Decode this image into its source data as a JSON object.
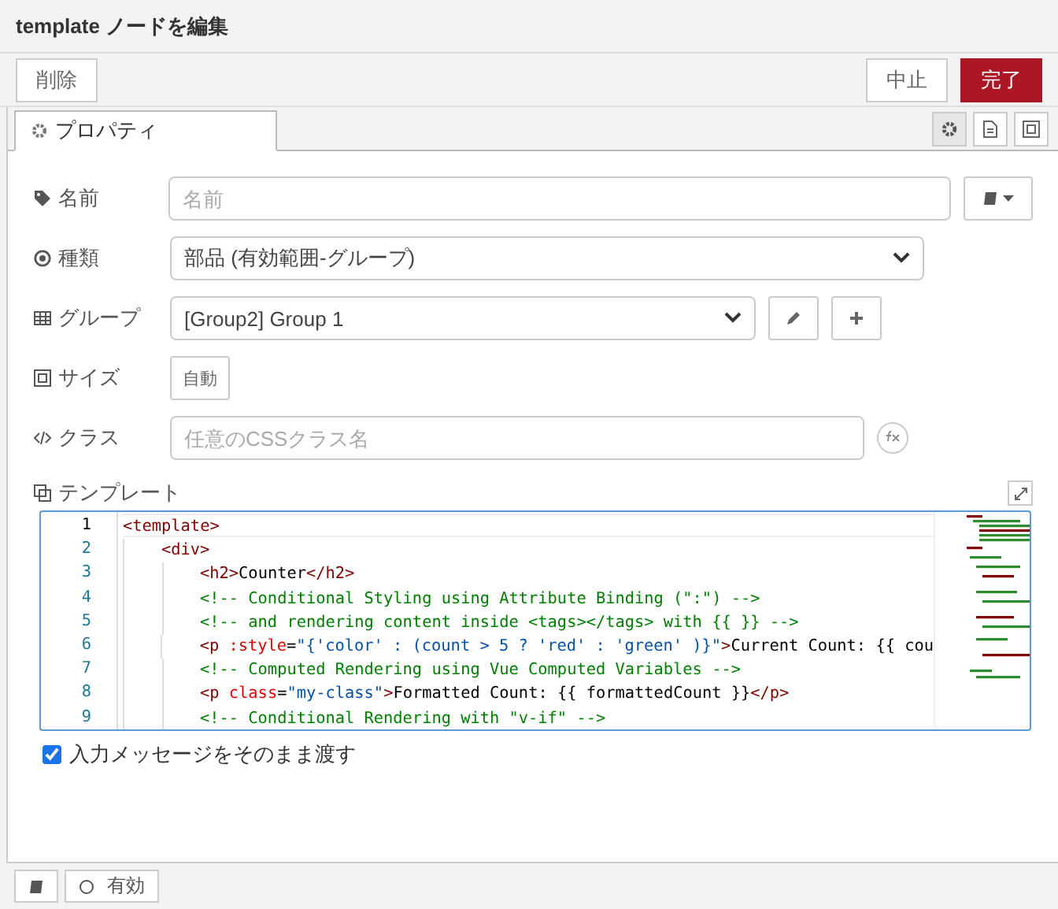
{
  "title": "template ノードを編集",
  "toolbar": {
    "delete": "削除",
    "cancel": "中止",
    "done": "完了"
  },
  "tabs": [
    {
      "label": "プロパティ",
      "selected": true
    }
  ],
  "fields": [
    {
      "kind": "input",
      "label": "名前",
      "placeholder": "名前"
    },
    {
      "kind": "select",
      "label": "種類",
      "value": "部品 (有効範囲-グループ)"
    },
    {
      "kind": "select-group",
      "label": "グループ",
      "value": "[Group2] Group 1"
    },
    {
      "kind": "size",
      "label": "サイズ",
      "value": "自動"
    },
    {
      "kind": "class",
      "label": "クラス",
      "placeholder": "任意のCSSクラス名"
    }
  ],
  "template_label": "テンプレート",
  "code": [
    {
      "n": "1",
      "tokens": [
        {
          "kind": "tag",
          "text": "<template>"
        }
      ],
      "children": [
        {
          "n": "2",
          "tokens": [
            {
              "kind": "tag",
              "text": "<div>"
            }
          ],
          "children": [
            {
              "n": "3",
              "tokens": [
                {
                  "kind": "tag",
                  "text": "<h2>"
                },
                {
                  "kind": "plain",
                  "text": "Counter"
                },
                {
                  "kind": "tag",
                  "text": "</h2>"
                }
              ]
            },
            {
              "n": "4",
              "tokens": [
                {
                  "kind": "comment",
                  "text": "<!-- Conditional Styling using Attribute Binding (\":\") -->"
                }
              ]
            },
            {
              "n": "5",
              "tokens": [
                {
                  "kind": "comment",
                  "text": "<!-- and rendering content inside <tags></tags> with {{ }} -->"
                }
              ]
            },
            {
              "n": "6",
              "tokens": [
                {
                  "kind": "tag",
                  "text": "<p "
                },
                {
                  "kind": "attr",
                  "text": ":style"
                },
                {
                  "kind": "plain",
                  "text": "="
                },
                {
                  "kind": "str",
                  "text": "\"{'color' : (count > 5 ? 'red' : 'green' )}\""
                },
                {
                  "kind": "tag",
                  "text": ">"
                },
                {
                  "kind": "plain",
                  "text": "Current Count: {{ cou"
                }
              ]
            },
            {
              "n": "7",
              "tokens": [
                {
                  "kind": "comment",
                  "text": "<!-- Computed Rendering using Vue Computed Variables -->"
                }
              ]
            },
            {
              "n": "8",
              "tokens": [
                {
                  "kind": "tag",
                  "text": "<p "
                },
                {
                  "kind": "attr",
                  "text": "class"
                },
                {
                  "kind": "plain",
                  "text": "="
                },
                {
                  "kind": "str",
                  "text": "\"my-class\""
                },
                {
                  "kind": "tag",
                  "text": ">"
                },
                {
                  "kind": "plain",
                  "text": "Formatted Count: {{ formattedCount }}"
                },
                {
                  "kind": "tag",
                  "text": "</p>"
                }
              ]
            },
            {
              "n": "9",
              "tokens": [
                {
                  "kind": "comment",
                  "text": "<!-- Conditional Rendering with \"v-if\" -->"
                }
              ]
            }
          ]
        }
      ]
    }
  ],
  "passthru": {
    "label": "入力メッセージをそのまま渡す",
    "checked": true
  },
  "footer": {
    "enabled_label": "有効",
    "enabled": false
  }
}
